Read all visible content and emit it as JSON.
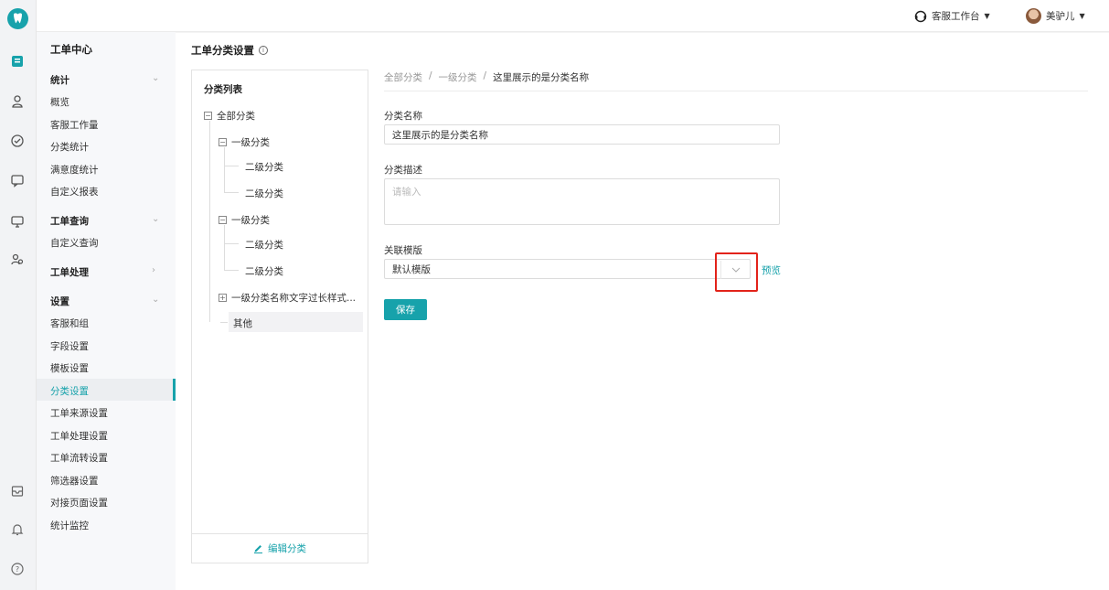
{
  "topbar": {
    "workspace_label": "客服工作台",
    "user_name": "美驴儿"
  },
  "nav": {
    "title": "工单中心",
    "groups": [
      {
        "label": "统计",
        "items": [
          "概览",
          "客服工作量",
          "分类统计",
          "满意度统计",
          "自定义报表"
        ]
      },
      {
        "label": "工单查询",
        "items": [
          "自定义查询"
        ]
      },
      {
        "label": "工单处理",
        "items": []
      },
      {
        "label": "设置",
        "items": [
          "客服和组",
          "字段设置",
          "模板设置",
          "分类设置",
          "工单来源设置",
          "工单处理设置",
          "工单流转设置",
          "筛选器设置",
          "对接页面设置",
          "统计监控"
        ]
      }
    ],
    "active_item": "分类设置"
  },
  "page": {
    "title": "工单分类设置"
  },
  "tree": {
    "title": "分类列表",
    "root": "全部分类",
    "level1_a": "一级分类",
    "level2_a1": "二级分类",
    "level2_a2": "二级分类",
    "level1_b": "一级分类",
    "level2_b1": "二级分类",
    "level2_b2": "二级分类",
    "level1_long": "一级分类名称文字过长样式...",
    "other": "其他",
    "edit_label": "编辑分类"
  },
  "breadcrumb": {
    "items": [
      "全部分类",
      "一级分类",
      "这里展示的是分类名称"
    ],
    "separator": "/"
  },
  "form": {
    "name_label": "分类名称",
    "name_value": "这里展示的是分类名称",
    "desc_label": "分类描述",
    "desc_placeholder": "请输入",
    "template_label": "关联模版",
    "template_value": "默认模版",
    "preview_label": "预览",
    "save_label": "保存"
  },
  "colors": {
    "accent": "#17a2ab",
    "highlight": "#e2231a"
  }
}
